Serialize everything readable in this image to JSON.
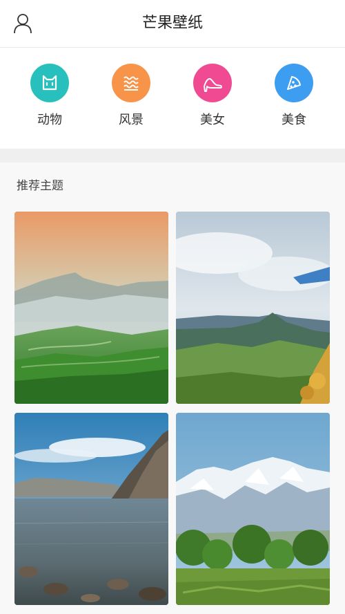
{
  "header": {
    "title": "芒果壁纸",
    "user_icon": "user-icon"
  },
  "categories": [
    {
      "label": "动物",
      "icon": "cat-icon",
      "color": "#27c0bd"
    },
    {
      "label": "风景",
      "icon": "waves-icon",
      "color": "#f7944a"
    },
    {
      "label": "美女",
      "icon": "high-heel-icon",
      "color": "#ef4a92"
    },
    {
      "label": "美食",
      "icon": "pizza-slice-icon",
      "color": "#3d9df0"
    }
  ],
  "recommended": {
    "title": "推荐主题",
    "tiles": [
      {
        "subject": "misty-mountain-tea-fields"
      },
      {
        "subject": "mountain-valley-blue-sky"
      },
      {
        "subject": "rocky-coast-lake"
      },
      {
        "subject": "snowy-mountains-trees"
      }
    ]
  }
}
